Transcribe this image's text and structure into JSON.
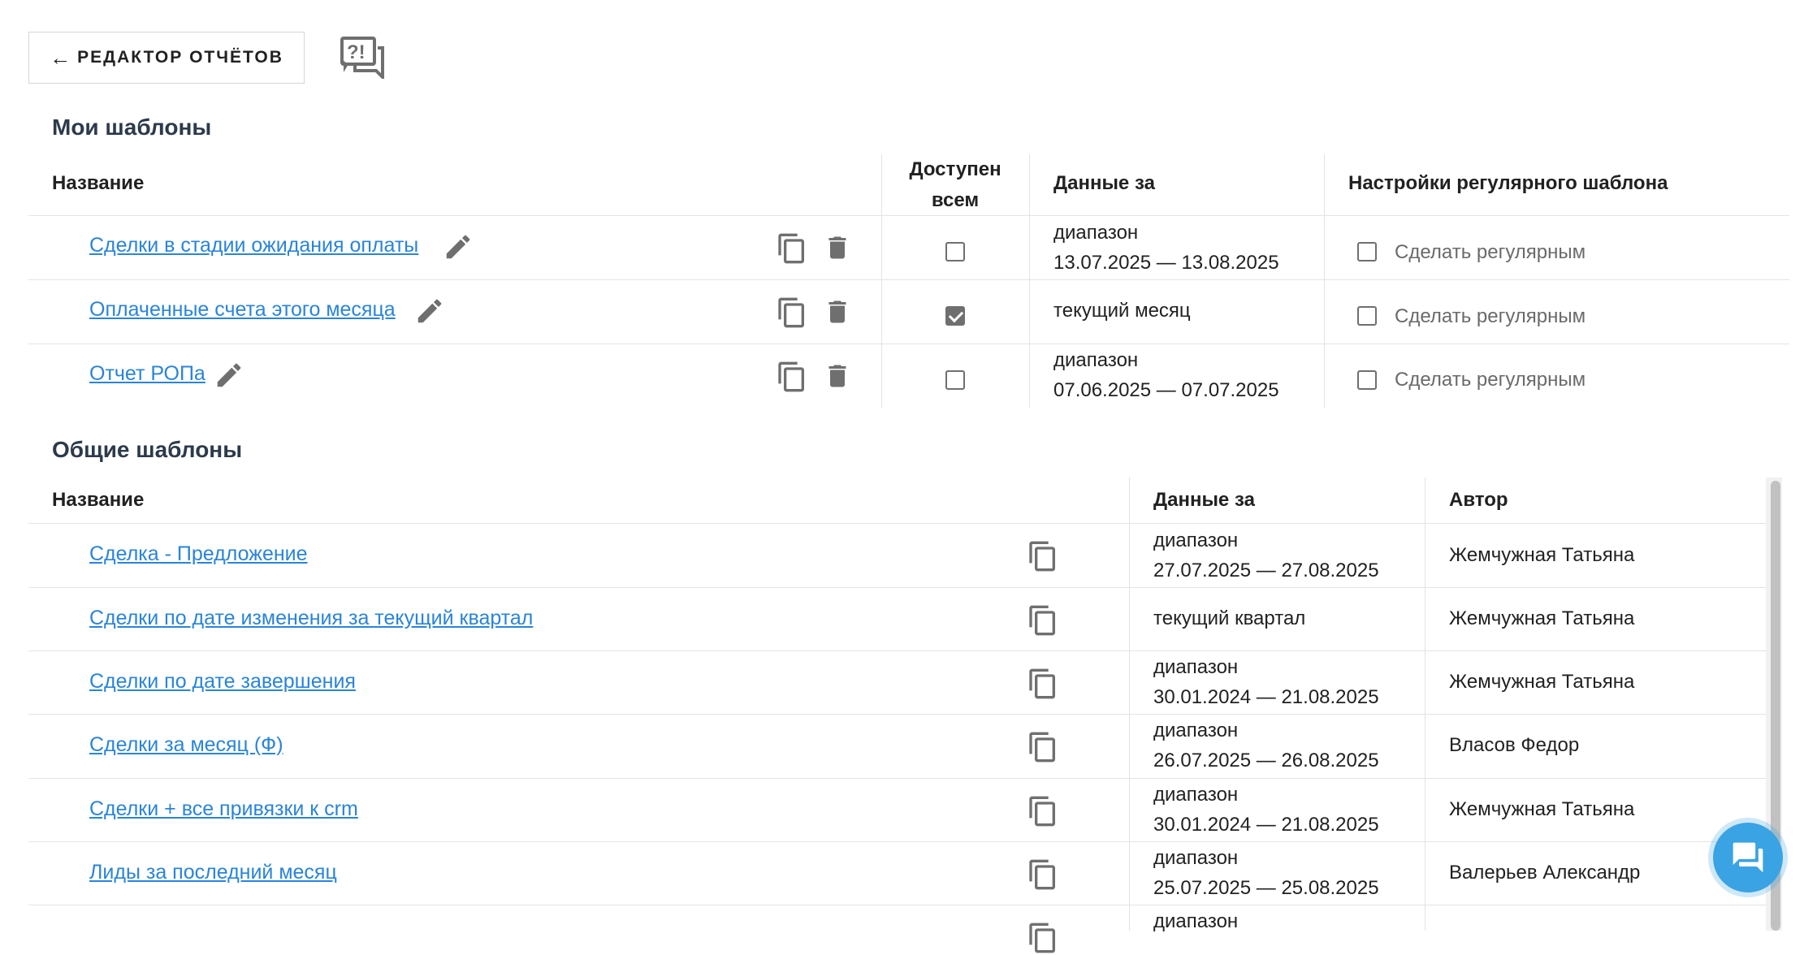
{
  "header": {
    "back_label": "РЕДАКТОР ОТЧЁТОВ"
  },
  "my_templates": {
    "title": "Мои шаблоны",
    "columns": {
      "name": "Название",
      "shared": "Доступен всем",
      "period": "Данные за",
      "regular": "Настройки регулярного шаблона"
    },
    "rows": [
      {
        "name": "Сделки в стадии ожидания оплаты",
        "shared": false,
        "period_line1": "диапазон",
        "period_line2": "13.07.2025 — 13.08.2025",
        "regular_label": "Сделать регулярным"
      },
      {
        "name": "Оплаченные счета этого месяца",
        "shared": true,
        "period_line1": "текущий месяц",
        "period_line2": "",
        "regular_label": "Сделать регулярным"
      },
      {
        "name": "Отчет РОПа",
        "shared": false,
        "period_line1": "диапазон",
        "period_line2": "07.06.2025 — 07.07.2025",
        "regular_label": "Сделать регулярным"
      }
    ]
  },
  "common_templates": {
    "title": "Общие шаблоны",
    "columns": {
      "name": "Название",
      "period": "Данные за",
      "author": "Автор"
    },
    "rows": [
      {
        "name": "Сделка - Предложение",
        "period_line1": "диапазон",
        "period_line2": "27.07.2025 — 27.08.2025",
        "author": "Жемчужная Татьяна"
      },
      {
        "name": "Сделки по дате изменения за текущий квартал",
        "period_line1": "текущий квартал",
        "period_line2": "",
        "author": "Жемчужная Татьяна"
      },
      {
        "name": "Сделки по дате завершения",
        "period_line1": "диапазон",
        "period_line2": "30.01.2024 — 21.08.2025",
        "author": "Жемчужная Татьяна"
      },
      {
        "name": "Сделки за месяц (Ф)",
        "period_line1": "диапазон",
        "period_line2": "26.07.2025 — 26.08.2025",
        "author": "Власов Федор"
      },
      {
        "name": "Сделки + все привязки к crm",
        "period_line1": "диапазон",
        "period_line2": "30.01.2024 — 21.08.2025",
        "author": "Жемчужная Татьяна"
      },
      {
        "name": "Лиды за последний месяц",
        "period_line1": "диапазон",
        "period_line2": "25.07.2025 — 25.08.2025",
        "author": "Валерьев Александр"
      },
      {
        "name": "",
        "period_line1": "диапазон",
        "period_line2": "",
        "author": ""
      }
    ]
  },
  "icons": {
    "faq": "faq-chat-icon",
    "copy": "copy-icon",
    "delete": "trash-icon",
    "edit": "pencil-icon",
    "chat": "chat-bubbles-icon"
  },
  "colors": {
    "link": "#2a84d9",
    "chat_button": "#3aa3e3",
    "icon_gray": "#6f6f6f"
  }
}
